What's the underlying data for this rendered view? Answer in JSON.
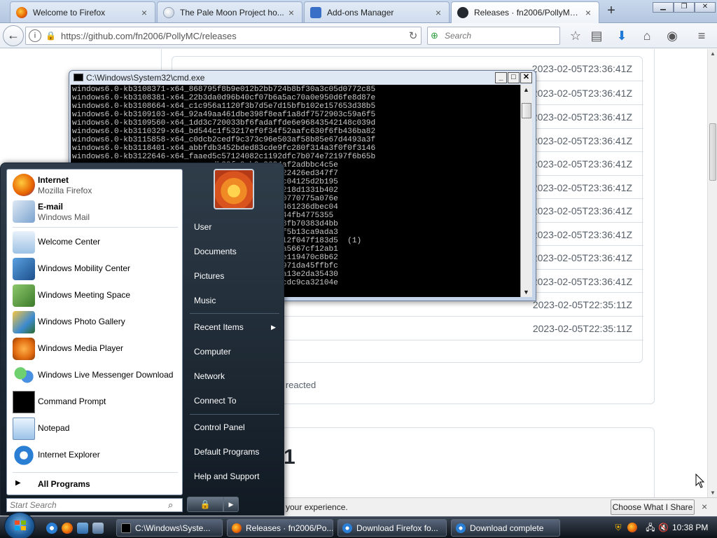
{
  "browser": {
    "tabs": [
      {
        "label": "Welcome to Firefox",
        "close": "×"
      },
      {
        "label": "The Pale Moon Project ho...",
        "close": "×"
      },
      {
        "label": "Add-ons Manager",
        "close": "×"
      },
      {
        "label": "Releases · fn2006/PollyMC ...",
        "close": "×"
      }
    ],
    "new_tab": "+",
    "url": "https://github.com/fn2006/PollyMC/releases",
    "search_placeholder": "Search"
  },
  "page": {
    "asset_times": [
      "2023-02-05T23:36:41Z",
      "2023-02-05T23:36:41Z",
      "2023-02-05T23:36:41Z",
      "2023-02-05T23:36:41Z",
      "2023-02-05T23:36:41Z",
      "2023-02-05T23:36:41Z",
      "2023-02-05T23:36:41Z",
      "2023-02-05T23:36:41Z",
      "2023-02-05T23:36:41Z",
      "2023-02-05T23:36:41Z",
      "2023-02-05T22:35:11Z",
      "2023-02-05T22:35:11Z"
    ],
    "reacted_fragment": "e reacted",
    "release_number_fragment": "1"
  },
  "notification": {
    "text_fragment": "e your experience.",
    "button_label": "Choose What I Share",
    "close": "×"
  },
  "cmd": {
    "title": "C:\\Windows\\System32\\cmd.exe",
    "lines": [
      "windows6.0-kb3108371-x64_868795f8b9e012b2bb724b8bf30a3c05d0772c85",
      "windows6.0-kb3108381-x64_22b3da0d96b40cf07b6a5ac70a0e950d6fe8d87e",
      "windows6.0-kb3108664-x64_c1c956a1120f3b7d5e7d15bfb102e157653d38b5",
      "windows6.0-kb3109103-x64_92a49aa461dbe398f8eaf1a8df7572903c59a6f5",
      "windows6.0-kb3109560-x64_1dd3c720033bf6fadaffde6e96843542148c039d",
      "windows6.0-kb3110329-x64_bd544c1f53217ef0f34f52aafc630f6fb436ba82",
      "windows6.0-kb3115858-x64_c0dcb2cedf9c373c96e503af58b85e67d4493a3f",
      "windows6.0-kb3118401-x64_abbfdb3452bded83cde9fc280f314a3f0f0f3146",
      "windows6.0-kb3122646-x64_faaed5c57124082c1192dfc7b074e72197f6b65b",
      "                              db32fc9eb9a3624af2adbbc4c5e",
      "                              d5160bb3eb373e322426ed347f7",
      "                              d4cb6e5631215b6c04125d2b195",
      "                              8e062bd206e990a218d1331b402",
      "                              f05d1362570a8970770775a076e",
      "                              30ce31d292ba706461236dbec04",
      "                              699f7a1d4cc7e5944fb4775355",
      "                              54abbf7cfa4c0398fb70383d4bb",
      "                              680b934691fee9cf5b13ca9ada3",
      "                              dca064695939ee312f047f183d5  (1)",
      "                              86d557fef149be4a5667cf12ab1",
      "                              ceb98ec6a53d507e119470c8b62",
      "                              4ae01f3309706e8971da45ffbfc",
      "                              dbf65da36f211bca13e2da35430",
      "                              0e1feff45e672b7cdc9ca32104e"
    ]
  },
  "startmenu": {
    "pinned": [
      {
        "title": "Internet",
        "subtitle": "Mozilla Firefox"
      },
      {
        "title": "E-mail",
        "subtitle": "Windows Mail"
      }
    ],
    "programs": [
      "Welcome Center",
      "Windows Mobility Center",
      "Windows Meeting Space",
      "Windows Photo Gallery",
      "Windows Media Player",
      "Windows Live Messenger Download",
      "Command Prompt",
      "Notepad",
      "Internet Explorer"
    ],
    "all_programs": "All Programs",
    "search_placeholder": "Start Search",
    "right_items": [
      "User",
      "Documents",
      "Pictures",
      "Music",
      "Recent Items",
      "Computer",
      "Network",
      "Connect To",
      "Control Panel",
      "Default Programs",
      "Help and Support"
    ]
  },
  "taskbar": {
    "tasks": [
      "C:\\Windows\\Syste...",
      "Releases · fn2006/Po...",
      "Download Firefox fo...",
      "Download complete"
    ],
    "clock": "10:38 PM"
  },
  "colors": {
    "firefox_orange": "#e66000",
    "github_border": "#d8dee4",
    "taskbar_dark": "#0d1218",
    "cmd_background": "#000000"
  }
}
